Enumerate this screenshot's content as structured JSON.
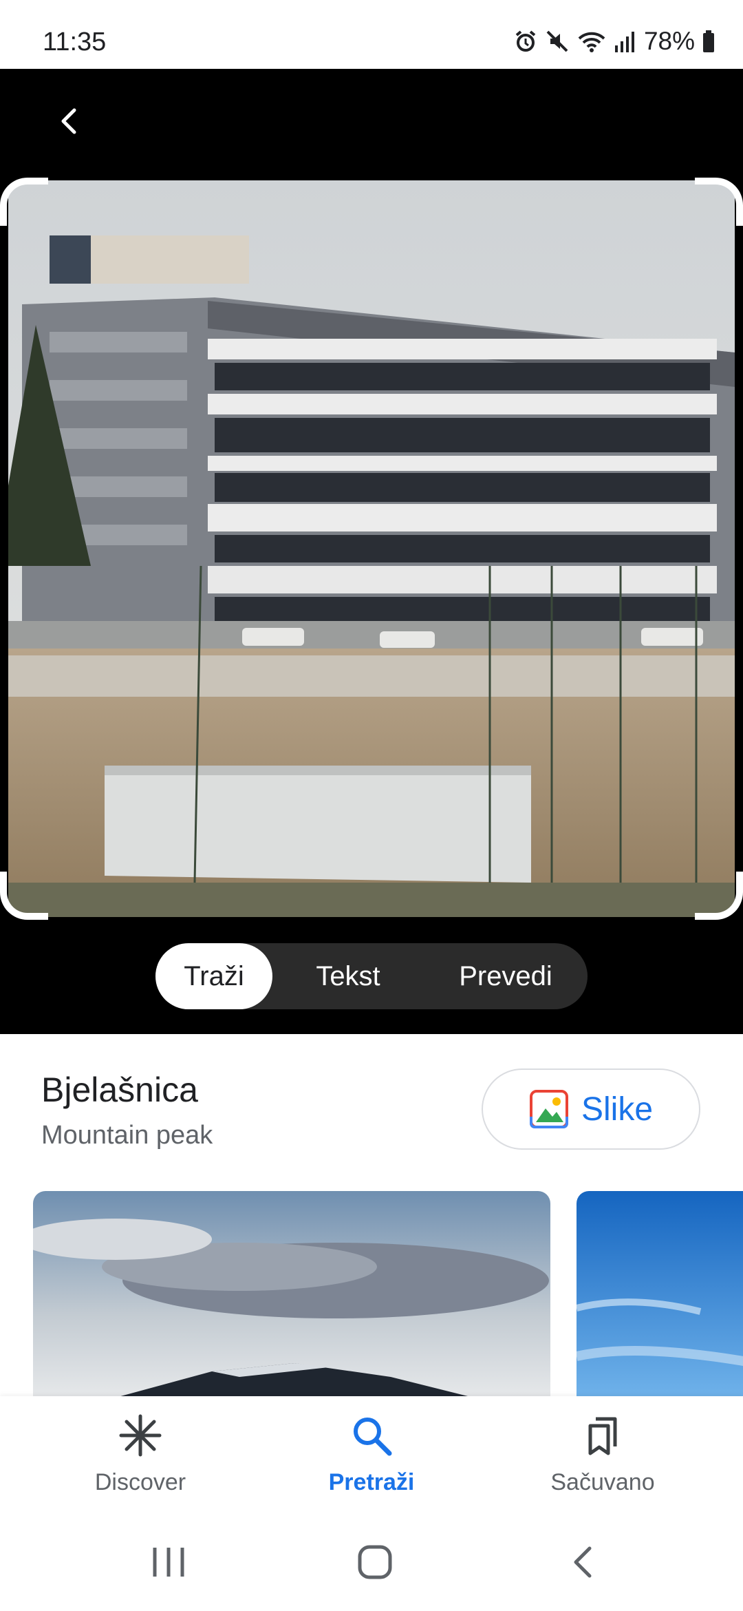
{
  "status_bar": {
    "time": "11:35",
    "battery": "78%",
    "icons": [
      "alarm-icon",
      "mute-icon",
      "wifi-icon",
      "signal-icon",
      "battery-icon"
    ]
  },
  "viewer": {
    "back_icon": "chevron-left-icon",
    "mode_tabs": [
      {
        "label": "Traži",
        "active": true
      },
      {
        "label": "Tekst",
        "active": false
      },
      {
        "label": "Prevedi",
        "active": false
      }
    ]
  },
  "result": {
    "title": "Bjelašnica",
    "subtitle": "Mountain peak",
    "images_button_label": "Slike"
  },
  "bottom_nav": {
    "items": [
      {
        "label": "Discover",
        "icon": "asterisk-icon",
        "active": false
      },
      {
        "label": "Pretraži",
        "icon": "search-icon",
        "active": true
      },
      {
        "label": "Sačuvano",
        "icon": "bookmarks-icon",
        "active": false
      }
    ]
  },
  "colors": {
    "accent": "#1a73e8",
    "viewer_background": "#000000",
    "tab_pill": "#2b2b2b"
  }
}
